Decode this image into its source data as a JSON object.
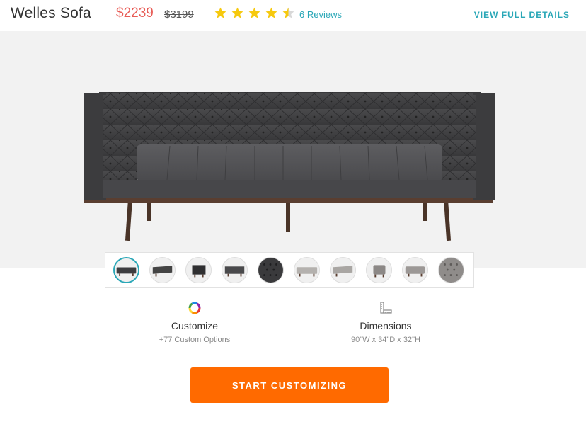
{
  "product": {
    "title": "Welles Sofa",
    "price": "$2239",
    "original_price": "$3199",
    "rating": 4.5,
    "rating_max": 5,
    "reviews_label": "6 Reviews",
    "view_details_label": "VIEW FULL DETAILS",
    "star_color": "#f6c90e",
    "price_color": "#e85c56",
    "link_color": "#2aa7b7"
  },
  "thumbnails": [
    {
      "name": "thumb-sofa-front",
      "selected": true
    },
    {
      "name": "thumb-sofa-angle"
    },
    {
      "name": "thumb-sofa-side"
    },
    {
      "name": "thumb-sofa-back"
    },
    {
      "name": "thumb-sofa-tufting-detail"
    },
    {
      "name": "thumb-sofa-light-front"
    },
    {
      "name": "thumb-sofa-light-angle"
    },
    {
      "name": "thumb-sofa-light-side"
    },
    {
      "name": "thumb-sofa-light-back"
    },
    {
      "name": "thumb-sofa-light-detail"
    }
  ],
  "customize": {
    "title": "Customize",
    "subtitle": "+77 Custom Options",
    "icon": "color-wheel-icon"
  },
  "dimensions": {
    "title": "Dimensions",
    "subtitle": "90\"W x 34\"D x 32\"H",
    "icon": "ruler-icon"
  },
  "cta": {
    "label": "START CUSTOMIZING",
    "color": "#ff6a00"
  }
}
